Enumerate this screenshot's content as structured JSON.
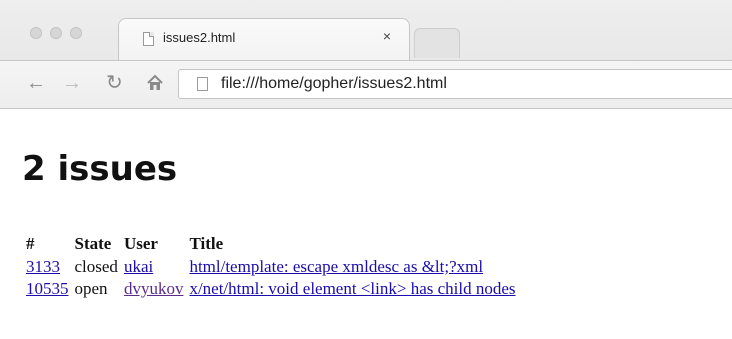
{
  "browser": {
    "tab": {
      "title": "issues2.html",
      "close": "×"
    },
    "url": "file:///home/gopher/issues2.html",
    "icons": {
      "back": "back-arrow-icon",
      "forward": "forward-arrow-icon",
      "reload": "reload-icon",
      "home": "home-icon",
      "page": "page-icon"
    }
  },
  "page": {
    "heading": "2 issues",
    "columns": [
      "#",
      "State",
      "User",
      "Title"
    ],
    "rows": [
      {
        "number": "3133",
        "state": "closed",
        "user": "ukai",
        "title": "html/template: escape xmldesc as &lt;?xml"
      },
      {
        "number": "10535",
        "state": "open",
        "user": "dvyukov",
        "title": "x/net/html: void element <link> has child nodes"
      }
    ],
    "colors": {
      "link": "#1a0dab",
      "visited_link": "#5b2b8a"
    }
  }
}
